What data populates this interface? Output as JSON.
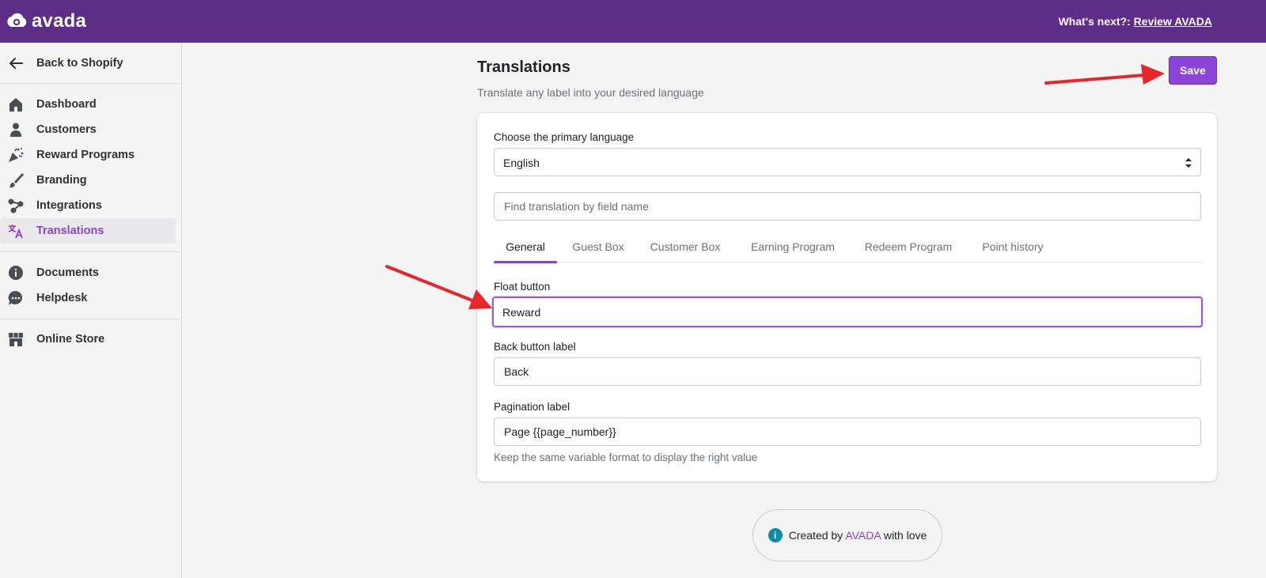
{
  "header": {
    "logo_text": "avada",
    "whats_next_label": "What's next?:",
    "whats_next_link": "Review AVADA"
  },
  "sidebar": {
    "back_label": "Back to Shopify",
    "items": [
      {
        "label": "Dashboard",
        "icon": "home-icon"
      },
      {
        "label": "Customers",
        "icon": "person-icon"
      },
      {
        "label": "Reward Programs",
        "icon": "confetti-icon"
      },
      {
        "label": "Branding",
        "icon": "paintbrush-icon"
      },
      {
        "label": "Integrations",
        "icon": "nodes-icon"
      },
      {
        "label": "Translations",
        "icon": "translate-icon",
        "active": true
      }
    ],
    "secondary": [
      {
        "label": "Documents",
        "icon": "info-icon"
      },
      {
        "label": "Helpdesk",
        "icon": "chat-icon"
      }
    ],
    "tertiary": [
      {
        "label": "Online Store",
        "icon": "store-icon"
      }
    ]
  },
  "page": {
    "title": "Translations",
    "subtitle": "Translate any label into your desired language",
    "save_label": "Save"
  },
  "form": {
    "primary_language_label": "Choose the primary language",
    "primary_language_value": "English",
    "search_placeholder": "Find translation by field name",
    "tabs": [
      "General",
      "Guest Box",
      "Customer Box",
      "Earning Program",
      "Redeem Program",
      "Point history"
    ],
    "active_tab": "General",
    "fields": [
      {
        "label": "Float button",
        "value": "Reward"
      },
      {
        "label": "Back button label",
        "value": "Back"
      },
      {
        "label": "Pagination label",
        "value": "Page {{page_number}}"
      }
    ],
    "help_text": "Keep the same variable format to display the right value"
  },
  "footer": {
    "prefix": "Created by",
    "brand": "AVADA",
    "suffix": "with love"
  },
  "colors": {
    "topbar": "#5e2d87",
    "accent": "#8a45c2",
    "save_button": "#8a45d8",
    "annotation_arrow": "#e8262a"
  }
}
